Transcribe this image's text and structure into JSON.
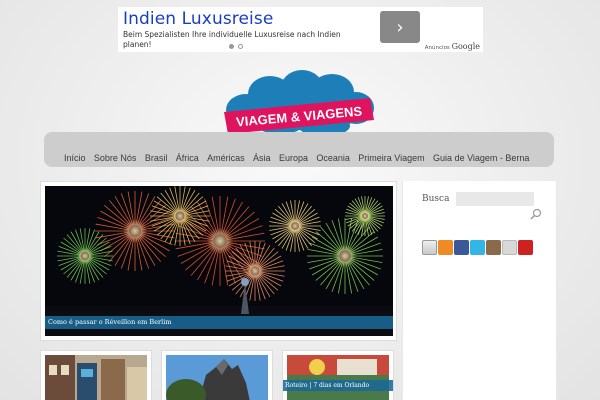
{
  "ad": {
    "title": "Indien Luxusreise",
    "text": "Beim Spezialisten Ihre individuelle Luxusreise nach Indien planen!",
    "arrow": "›",
    "adchoices": "Anúncios",
    "google": "Google"
  },
  "logo": {
    "text": "VIAGEM & VIAGENS",
    "colors": {
      "cloud": "#1e7fb8",
      "banner": "#e0135e"
    }
  },
  "nav": {
    "items": [
      "Início",
      "Sobre Nós",
      "Brasil",
      "África",
      "Américas",
      "Ásia",
      "Europa",
      "Oceania",
      "Primeira Viagem",
      "Guia de Viagem - Berna"
    ]
  },
  "featured": {
    "caption": "Como é passar o Réveillon em Berlim"
  },
  "thumbs": [
    {
      "caption": ""
    },
    {
      "caption": ""
    },
    {
      "caption": "Roteiro | 7 dias em Orlando"
    }
  ],
  "sidebar": {
    "search_label": "Busca",
    "search_value": "",
    "social_icons": [
      "email-icon",
      "rss-icon",
      "facebook-icon",
      "twitter-icon",
      "instagram-icon",
      "google-plus-icon",
      "youtube-icon"
    ]
  },
  "colors": {
    "accent": "#1a6996",
    "nav_bg": "#cdcdcd",
    "ad_title": "#1a3dc2"
  }
}
